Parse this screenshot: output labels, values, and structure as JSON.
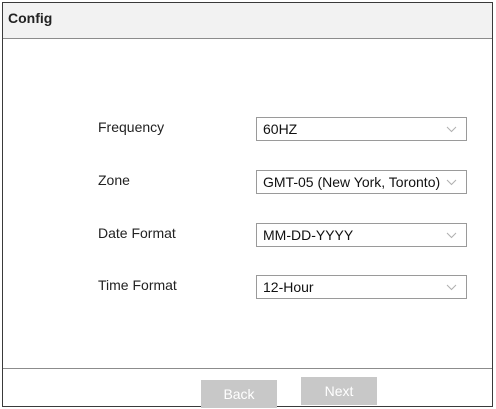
{
  "dialog": {
    "title": "Config"
  },
  "form": {
    "fields": [
      {
        "label": "Frequency",
        "value": "60HZ"
      },
      {
        "label": "Zone",
        "value": "GMT-05 (New York, Toronto)"
      },
      {
        "label": "Date Format",
        "value": "MM-DD-YYYY"
      },
      {
        "label": "Time Format",
        "value": "12-Hour"
      }
    ]
  },
  "footer": {
    "back_label": "Back",
    "next_label": "Next"
  },
  "colors": {
    "button_bg": "#c8c8c8",
    "button_text": "#ffffff",
    "border": "#3a3a3a"
  },
  "icons": {
    "dropdown": "chevron-down-icon"
  }
}
